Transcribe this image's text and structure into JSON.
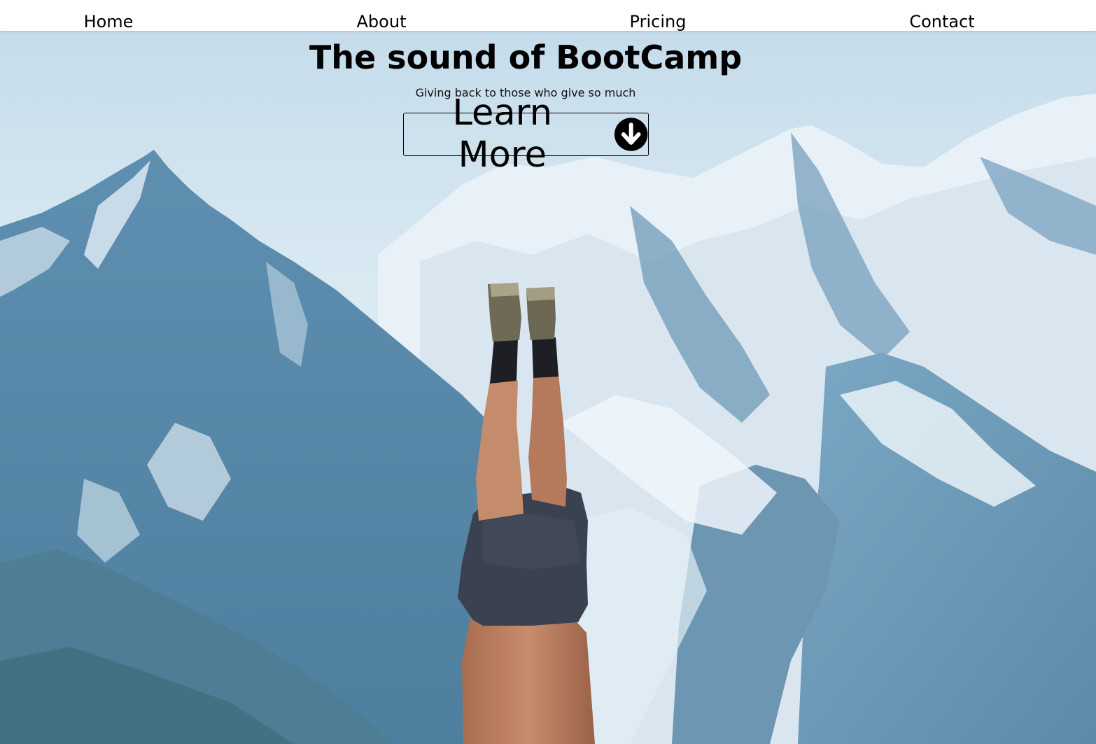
{
  "nav": {
    "items": [
      {
        "label": "Home"
      },
      {
        "label": "About"
      },
      {
        "label": "Pricing"
      },
      {
        "label": "Contact"
      }
    ]
  },
  "hero": {
    "title": "The sound of BootCamp",
    "subtitle": "Giving back to those who give so much",
    "cta": {
      "label": "Learn More",
      "icon": "arrow-circle-down-icon"
    },
    "background": "mountains-handstand-photo"
  },
  "colors": {
    "text": "#000000",
    "nav_bg": "#ffffff",
    "sky": "#cfe3ef",
    "mountain": "#6d9cbb",
    "snow": "#eef5fa"
  }
}
